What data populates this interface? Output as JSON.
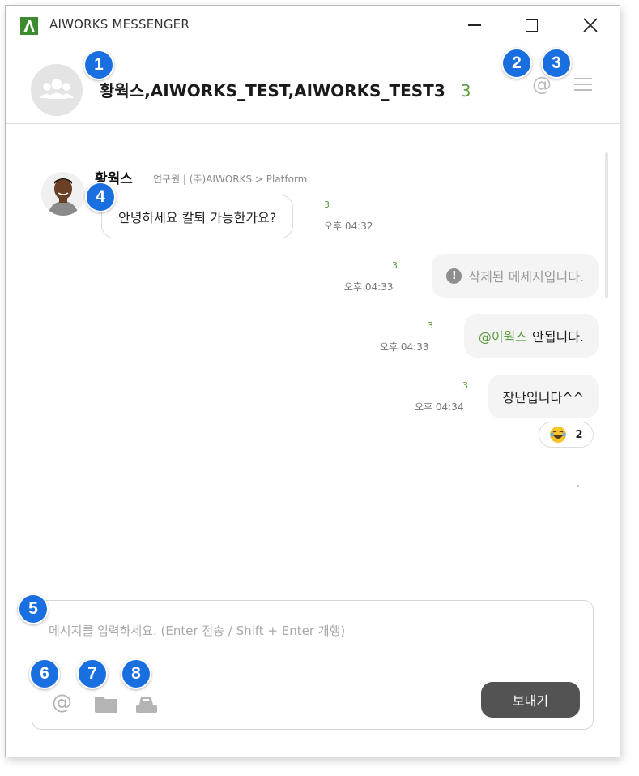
{
  "window": {
    "title": "AIWORKS MESSENGER",
    "controls": {
      "minimize": "minimize",
      "maximize": "maximize",
      "close": "close"
    }
  },
  "header": {
    "room_name": "황웍스,AIWORKS_TEST,AIWORKS_TEST3",
    "member_count": "3",
    "mention_icon": "at-icon",
    "menu_icon": "menu-icon"
  },
  "messages": {
    "incoming": {
      "sender_name": "황웍스",
      "sender_info": "연구원 | (주)AIWORKS > Platform",
      "text": "안녕하세요 칼퇴 가능한가요?",
      "unread": "3",
      "time": "오후 04:32"
    },
    "outgoing": [
      {
        "type": "deleted",
        "text": "삭제된 메세지입니다.",
        "unread": "3",
        "time": "오후 04:33"
      },
      {
        "type": "mention",
        "mention": "@이웍스",
        "text": "안됩니다.",
        "unread": "3",
        "time": "오후 04:33"
      },
      {
        "type": "text",
        "text": "장난입니다^^",
        "unread": "3",
        "time": "오후 04:34"
      }
    ],
    "reaction": {
      "emoji": "laughing-tears-emoji",
      "count": "2"
    }
  },
  "composer": {
    "placeholder": "메시지를 입력하세요. (Enter 전송 / Shift + Enter 개행)",
    "send_label": "보내기",
    "tools": [
      "at-icon",
      "folder-icon",
      "capture-icon"
    ]
  },
  "callouts": [
    "1",
    "2",
    "3",
    "4",
    "5",
    "6",
    "7",
    "8"
  ],
  "colors": {
    "brand_green": "#3d8b2f",
    "accent_green": "#5a9a3c",
    "callout_blue": "#1a6fe0",
    "send_button": "#535353"
  }
}
